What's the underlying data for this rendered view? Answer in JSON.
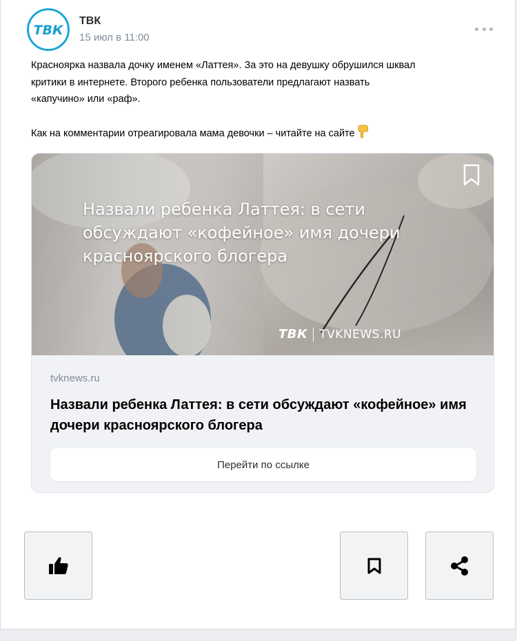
{
  "post": {
    "author": "ТВК",
    "avatar_text": "ТВК",
    "date": "15 июл в 11:00",
    "text_paragraph_1": "Красноярка назвала дочку именем «Латтея». За это на девушку обрушился шквал\nкритики в интернете. Второго ребенка пользователи предлагают назвать\n«капучино» или «раф».",
    "text_paragraph_2": "Как на комментарии отреагировала мама девочки – читайте на сайте",
    "emoji": "point-down-icon"
  },
  "link": {
    "image_title": "Назвали ребенка Латтея: в сети обсуждают «кофейное» имя дочери красноярского блогера",
    "image_brand_mark": "ТВК",
    "image_brand_site": "TVKNEWS.RU",
    "domain": "tvknews.ru",
    "title": "Назвали ребенка Латтея: в сети обсуждают «кофейное» имя дочери красноярского блогера",
    "button_label": "Перейти по ссылке"
  },
  "actions": {
    "like": "thumbs-up-icon",
    "bookmark": "bookmark-icon",
    "share": "share-icon"
  },
  "colors": {
    "brand": "#1aa7d8",
    "muted": "#818c99"
  }
}
